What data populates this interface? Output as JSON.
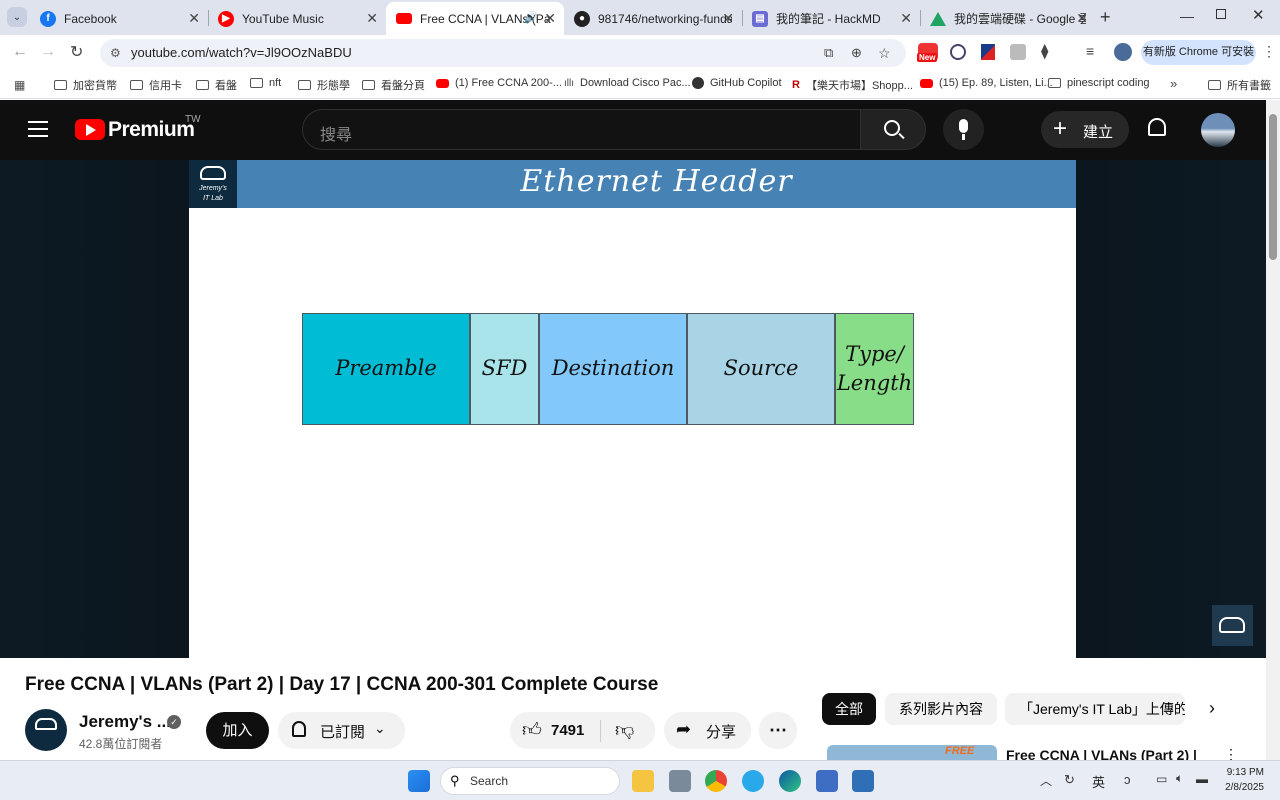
{
  "browser": {
    "tabs": [
      {
        "title": "Facebook",
        "icon": "facebook-icon",
        "color": "#1877f2"
      },
      {
        "title": "YouTube Music",
        "icon": "youtube-music-icon",
        "color": "#ff0000"
      },
      {
        "title": "Free CCNA | VLANs (Pa",
        "icon": "youtube-icon",
        "color": "#ff0000"
      },
      {
        "title": "981746/networking-funda",
        "icon": "github-icon",
        "color": "#222222"
      },
      {
        "title": "我的筆記 - HackMD",
        "icon": "hackmd-icon",
        "color": "#6b6bd6"
      },
      {
        "title": "我的雲端硬碟 - Google 雲",
        "icon": "google-drive-icon",
        "color": "#1fa463"
      }
    ],
    "url": "youtube.com/watch?v=Jl9OOzNaBDU",
    "update_label": "有新版 Chrome 可安裝",
    "bookmarks": [
      "加密貨幣",
      "信用卡",
      "看盤",
      "nft",
      "形態學",
      "看盤分頁",
      "(1) Free CCNA 200-...",
      "Download Cisco Pac...",
      "GitHub Copilot",
      "【樂天市場】Shopp...",
      "(15) Ep. 89, Listen, Li...",
      "pinescript coding"
    ],
    "all_bookmarks": "所有書籤",
    "new_badge": "New"
  },
  "youtube": {
    "logo_text": "Premium",
    "region": "TW",
    "search_placeholder": "搜尋",
    "create_label": "建立"
  },
  "slide": {
    "logo_line1": "Jeremy's",
    "logo_line2": "IT Lab",
    "title": "Ethernet Header",
    "fields": [
      {
        "label": "Preamble",
        "color": "#00bcd4"
      },
      {
        "label": "SFD",
        "color": "#a8e4ea"
      },
      {
        "label": "Destination",
        "color": "#82c8fa"
      },
      {
        "label": "Source",
        "color": "#a9d4e6"
      },
      {
        "label": "Type/ Length",
        "color": "#88de88"
      }
    ]
  },
  "video_info": {
    "title": "Free CCNA | VLANs (Part 2) | Day 17 | CCNA 200-301 Complete Course",
    "channel": "Jeremy's ...",
    "subscribers": "42.8萬位訂閱者",
    "join_label": "加入",
    "subscribed_label": "已訂閱",
    "likes": "7491",
    "share_label": "分享"
  },
  "sidebar": {
    "chips": [
      "全部",
      "系列影片內容",
      "「Jeremy's IT Lab」上傳的"
    ],
    "next_title": "Free CCNA | VLANs (Part 2) |",
    "thumb_text": "FREE"
  },
  "taskbar": {
    "search_label": "Search",
    "ime": "英",
    "time": "9:13 PM",
    "date": "2/8/2025"
  }
}
